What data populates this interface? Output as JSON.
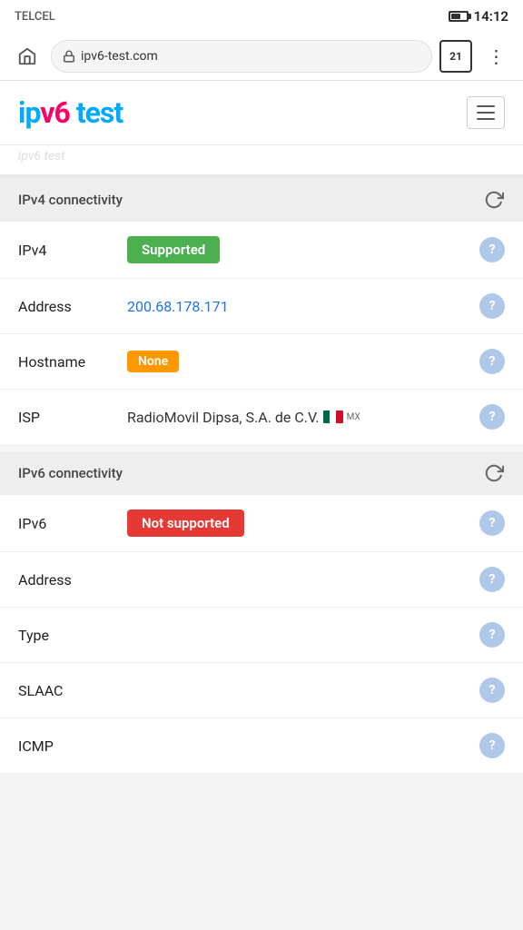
{
  "statusBar": {
    "carrier": "TELCEL",
    "time": "14:12",
    "batteryLevel": 55
  },
  "browserChrome": {
    "addressUrl": "ipv6-test.com",
    "tabCount": "21",
    "homeLabel": "home",
    "lockLabel": "lock"
  },
  "siteHeader": {
    "logoPrefix": "ip",
    "logoHighlight": "v6",
    "logoSuffix": " test",
    "menuLabel": "menu"
  },
  "watermark": {
    "text": "ipv6 test"
  },
  "ipv4Section": {
    "title": "IPv4 connectivity",
    "refreshLabel": "refresh",
    "rows": [
      {
        "label": "IPv4",
        "valueType": "badge-supported",
        "value": "Supported"
      },
      {
        "label": "Address",
        "valueType": "link",
        "value": "200.68.178.171"
      },
      {
        "label": "Hostname",
        "valueType": "badge-none",
        "value": "None"
      },
      {
        "label": "ISP",
        "valueType": "isp",
        "value": "RadioMovil Dipsa, S.A. de C.V.",
        "flag": "MX"
      }
    ]
  },
  "ipv6Section": {
    "title": "IPv6 connectivity",
    "refreshLabel": "refresh",
    "rows": [
      {
        "label": "IPv6",
        "valueType": "badge-not-supported",
        "value": "Not supported"
      },
      {
        "label": "Address",
        "valueType": "text",
        "value": ""
      },
      {
        "label": "Type",
        "valueType": "text",
        "value": ""
      },
      {
        "label": "SLAAC",
        "valueType": "text",
        "value": ""
      },
      {
        "label": "ICMP",
        "valueType": "text",
        "value": ""
      }
    ]
  },
  "help": {
    "label": "?"
  }
}
